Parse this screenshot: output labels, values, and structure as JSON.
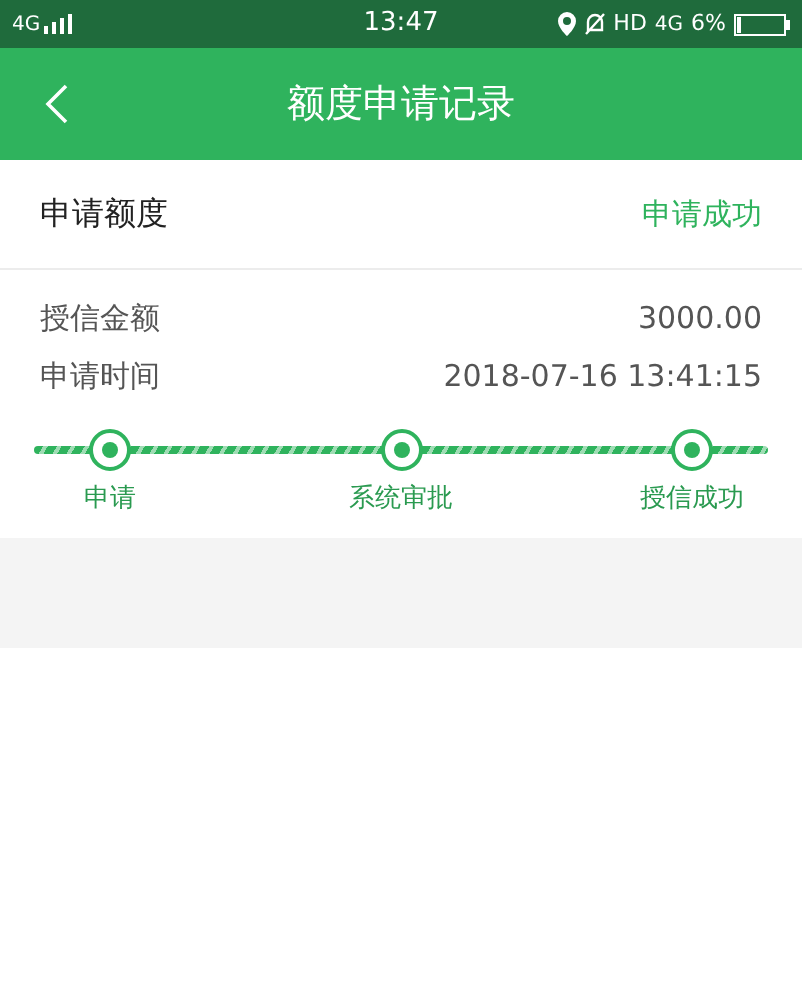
{
  "status_bar": {
    "network": "4G",
    "time": "13:47",
    "hd": "HD",
    "network_2": "4G",
    "battery": "6%"
  },
  "header": {
    "title": "额度申请记录"
  },
  "record": {
    "label": "申请额度",
    "status": "申请成功"
  },
  "details": [
    {
      "label": "授信金额",
      "value": "3000.00"
    },
    {
      "label": "申请时间",
      "value": "2018-07-16 13:41:15"
    }
  ],
  "steps": [
    {
      "label": "申请"
    },
    {
      "label": "系统审批"
    },
    {
      "label": "授信成功"
    }
  ]
}
